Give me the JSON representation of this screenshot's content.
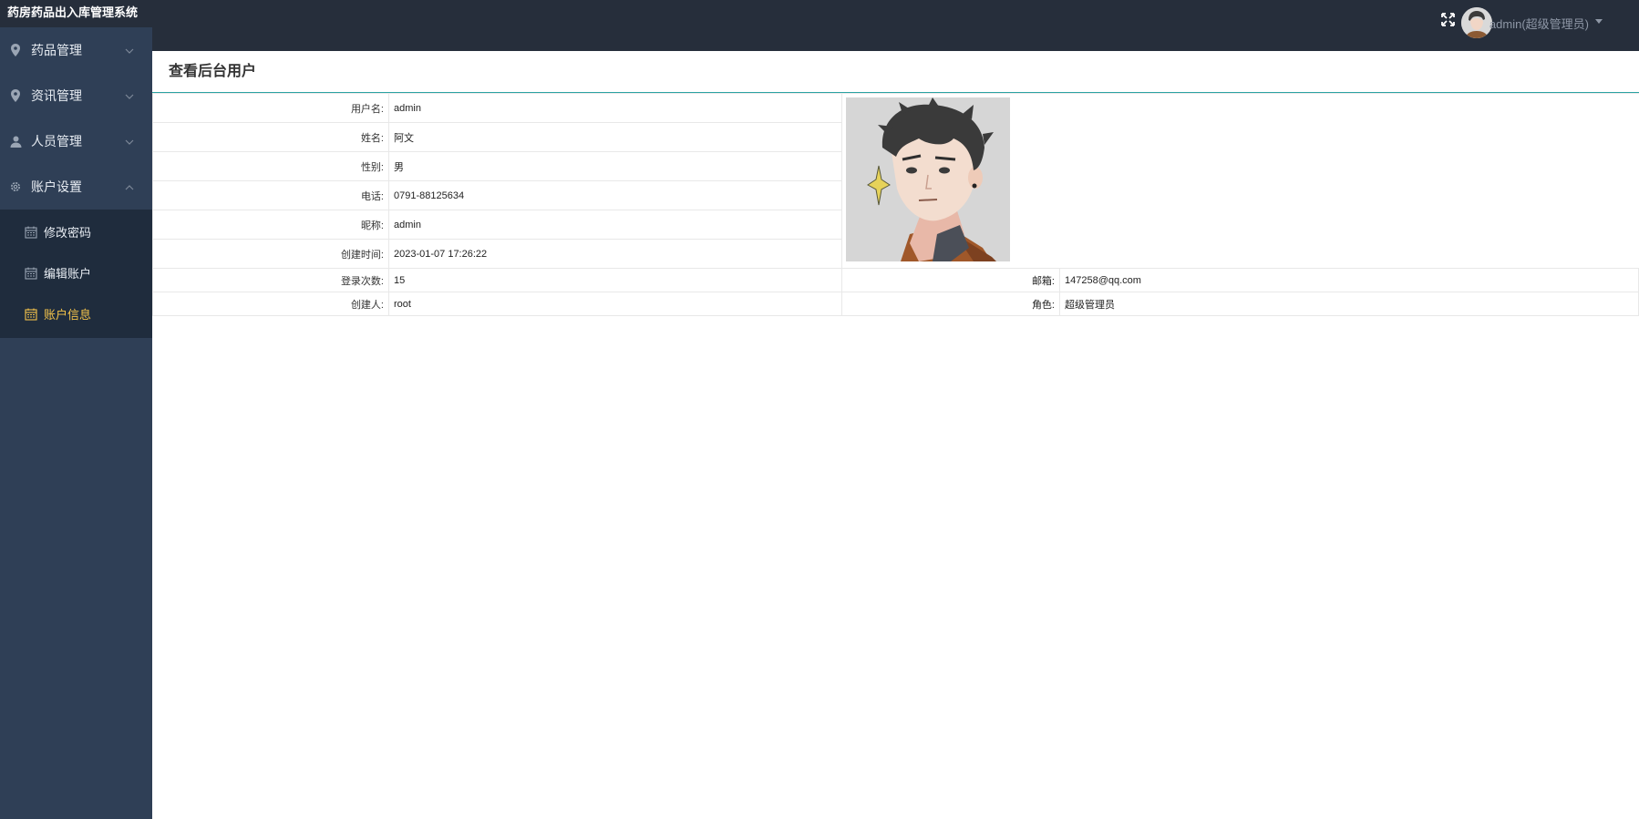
{
  "app": {
    "title": "药房药品出入库管理系统"
  },
  "sidebar": {
    "items": [
      {
        "label": "药品管理",
        "icon": "location-pin-icon",
        "expanded": false
      },
      {
        "label": "资讯管理",
        "icon": "location-pin-icon",
        "expanded": false
      },
      {
        "label": "人员管理",
        "icon": "user-icon",
        "expanded": false
      },
      {
        "label": "账户设置",
        "icon": "gear-icon",
        "expanded": true,
        "children": [
          {
            "label": "修改密码",
            "icon": "calendar-icon",
            "active": false
          },
          {
            "label": "编辑账户",
            "icon": "calendar-icon",
            "active": false
          },
          {
            "label": "账户信息",
            "icon": "calendar-icon",
            "active": true
          }
        ]
      }
    ]
  },
  "header": {
    "user_label": "admin(超级管理员)",
    "fullscreen_icon": "expand-icon",
    "caret_icon": "caret-down-icon"
  },
  "page": {
    "title": "查看后台用户",
    "fields": {
      "username": {
        "label": "用户名:",
        "value": "admin"
      },
      "name": {
        "label": "姓名:",
        "value": "阿文"
      },
      "gender": {
        "label": "性别:",
        "value": "男"
      },
      "phone": {
        "label": "电话:",
        "value": "0791-88125634"
      },
      "nickname": {
        "label": "昵称:",
        "value": "admin"
      },
      "created_at": {
        "label": "创建时间:",
        "value": "2023-01-07 17:26:22"
      },
      "login_count": {
        "label": "登录次数:",
        "value": "15"
      },
      "email": {
        "label": "邮箱:",
        "value": "147258@qq.com"
      },
      "creator": {
        "label": "创建人:",
        "value": "root"
      },
      "role": {
        "label": "角色:",
        "value": "超级管理员"
      }
    }
  },
  "colors": {
    "sidebar_bg": "#2f3f56",
    "topbar_bg": "#262e3b",
    "submenu_bg": "#1f2c3d",
    "active": "#f4c34a",
    "accent_line": "#2aa3a3"
  }
}
